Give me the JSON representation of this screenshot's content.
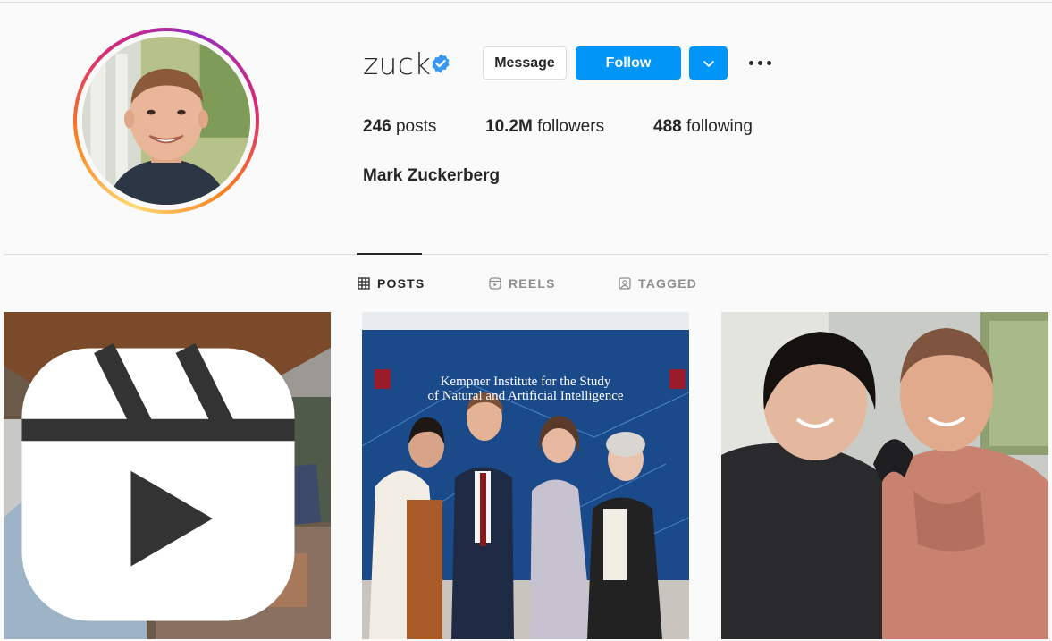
{
  "profile": {
    "username": "zuck",
    "full_name": "Mark Zuckerberg",
    "verified_icon": "verified-badge-icon",
    "stats": {
      "posts_count": "246",
      "posts_label": "posts",
      "followers_count": "10.2M",
      "followers_label": "followers",
      "following_count": "488",
      "following_label": "following"
    }
  },
  "actions": {
    "message_label": "Message",
    "follow_label": "Follow",
    "dropdown_icon": "chevron-down-icon",
    "more_icon": "more-options-icon"
  },
  "tabs": [
    {
      "label": "POSTS",
      "icon": "grid-icon",
      "active": true
    },
    {
      "label": "REELS",
      "icon": "reels-icon",
      "active": false
    },
    {
      "label": "TAGGED",
      "icon": "tagged-icon",
      "active": false
    }
  ],
  "posts": [
    {
      "type": "reel",
      "badge_icon": "reels-icon"
    },
    {
      "type": "photo",
      "banner_line1": "Kempner Institute for the Study",
      "banner_line2": "of Natural and Artificial Intelligence"
    },
    {
      "type": "photo"
    }
  ],
  "colors": {
    "accent": "#0095f6",
    "text": "#262626",
    "muted": "#8e8e8e",
    "border": "#dbdbdb",
    "background": "#fafafa"
  }
}
